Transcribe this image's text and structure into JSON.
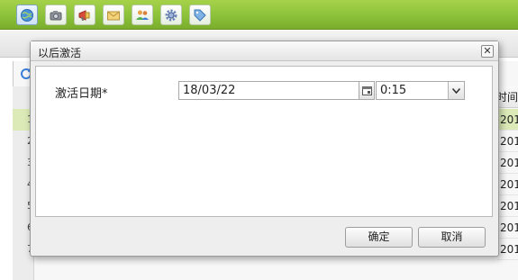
{
  "toolbar": {
    "buttons": [
      {
        "icon": "globe-icon",
        "active": true
      },
      {
        "icon": "camera-icon",
        "active": false
      },
      {
        "icon": "megaphone-icon",
        "active": false
      },
      {
        "icon": "envelope-icon",
        "active": false
      },
      {
        "icon": "users-icon",
        "active": false
      },
      {
        "icon": "gear-icon",
        "active": false
      },
      {
        "icon": "tag-icon",
        "active": false
      }
    ],
    "accent_color": "#8cc13a"
  },
  "background_grid": {
    "column_header": "时间",
    "row_numbers": [
      "1",
      "2",
      "3",
      "4",
      "5",
      "6",
      "7"
    ],
    "cells": [
      "201",
      "201",
      "201",
      "201",
      "201",
      "201",
      "201"
    ],
    "selected_row_color": "#dbeab7"
  },
  "dialog": {
    "title": "以后激活",
    "close_glyph": "✕",
    "field_label": "激活日期*",
    "date_value": "18/03/22",
    "time_value": "0:15",
    "ok_label": "确定",
    "cancel_label": "取消"
  }
}
